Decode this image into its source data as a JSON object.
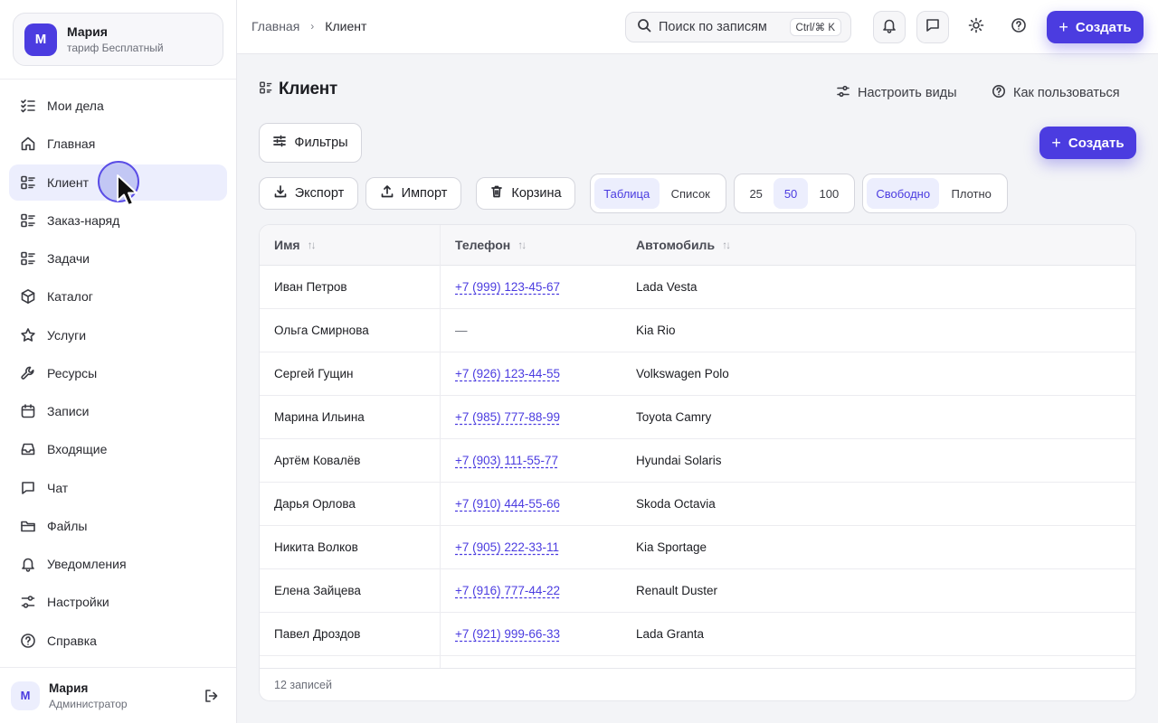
{
  "account": {
    "initial": "М",
    "name": "Мария",
    "plan": "тариф Бесплатный"
  },
  "sidebar": {
    "items": [
      {
        "label": "Мои дела",
        "icon": "checklist-icon"
      },
      {
        "label": "Главная",
        "icon": "home-icon"
      },
      {
        "label": "Клиент",
        "icon": "list-icon",
        "active": true
      },
      {
        "label": "Заказ-наряд",
        "icon": "list-icon"
      },
      {
        "label": "Задачи",
        "icon": "list-icon"
      },
      {
        "label": "Каталог",
        "icon": "box-icon"
      },
      {
        "label": "Услуги",
        "icon": "star-icon"
      },
      {
        "label": "Ресурсы",
        "icon": "wrench-icon"
      },
      {
        "label": "Записи",
        "icon": "calendar-icon"
      },
      {
        "label": "Входящие",
        "icon": "inbox-icon"
      },
      {
        "label": "Чат",
        "icon": "chat-icon"
      },
      {
        "label": "Файлы",
        "icon": "folder-icon"
      },
      {
        "label": "Уведомления",
        "icon": "bell-icon"
      },
      {
        "label": "Настройки",
        "icon": "sliders-icon"
      },
      {
        "label": "Справка",
        "icon": "help-icon"
      }
    ]
  },
  "user": {
    "initial": "М",
    "name": "Мария",
    "role": "Администратор"
  },
  "topbar": {
    "breadcrumb": {
      "home": "Главная",
      "current": "Клиент"
    },
    "search_placeholder": "Поиск по записям",
    "search_shortcut": "Ctrl/⌘ K",
    "create_label": "Создать"
  },
  "page": {
    "title": "Клиент",
    "configure_views": "Настроить виды",
    "how_to_use": "Как пользоваться",
    "filters_label": "Фильтры",
    "create_label": "Создать",
    "export_label": "Экспорт",
    "import_label": "Импорт",
    "trash_label": "Корзина",
    "view_mode": {
      "options": [
        "Таблица",
        "Список"
      ],
      "selected": "Таблица"
    },
    "page_size": {
      "options": [
        "25",
        "50",
        "100"
      ],
      "selected": "50"
    },
    "density": {
      "options": [
        "Свободно",
        "Плотно"
      ],
      "selected": "Свободно"
    }
  },
  "table": {
    "columns": [
      "Имя",
      "Телефон",
      "Автомобиль"
    ],
    "rows": [
      {
        "name": "Иван Петров",
        "phone": "+7 (999) 123-45-67",
        "car": "Lada Vesta"
      },
      {
        "name": "Ольга Смирнова",
        "phone": "—",
        "car": "Kia Rio"
      },
      {
        "name": "Сергей Гущин",
        "phone": "+7 (926) 123-44-55",
        "car": "Volkswagen Polo"
      },
      {
        "name": "Марина Ильина",
        "phone": "+7 (985) 777-88-99",
        "car": "Toyota Camry"
      },
      {
        "name": "Артём Ковалёв",
        "phone": "+7 (903) 111-55-77",
        "car": "Hyundai Solaris"
      },
      {
        "name": "Дарья Орлова",
        "phone": "+7 (910) 444-55-66",
        "car": "Skoda Octavia"
      },
      {
        "name": "Никита Волков",
        "phone": "+7 (905) 222-33-11",
        "car": "Kia Sportage"
      },
      {
        "name": "Елена Зайцева",
        "phone": "+7 (916) 777-44-22",
        "car": "Renault Duster"
      },
      {
        "name": "Павел Дроздов",
        "phone": "+7 (921) 999-66-33",
        "car": "Lada Granta"
      }
    ],
    "footer": "12 записей"
  },
  "colors": {
    "accent": "#4b3ce0",
    "accent_soft": "#eceefd"
  }
}
